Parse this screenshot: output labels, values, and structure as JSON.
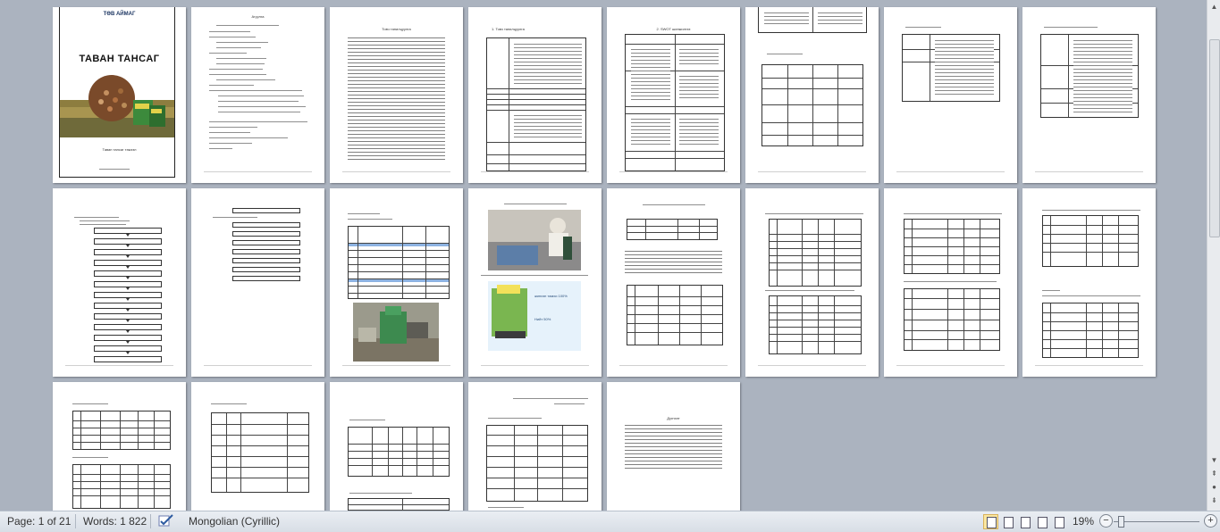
{
  "cover": {
    "header": "ТӨВ АЙМАГ",
    "title": "ТАВАН ТАНСАГ",
    "subtitle": "Таван тансаг тэжээл"
  },
  "pages": {
    "p2_heading": "Агуулга",
    "p3_heading": "Товч танилцуулга",
    "p4_heading": "1. Товч танилцуулга",
    "p5_heading": "2. SWOT шинжилгээ",
    "p15_heading": "Дүгнэлт",
    "p10_badge_line1": "жинхэн тамхи 100%",
    "p10_badge_line2": "Нийт 50%"
  },
  "scrollbar": {
    "up_icon": "arrow-up-icon",
    "down_icon": "arrow-down-icon",
    "prev_page_icon": "double-arrow-up-icon",
    "browse_icon": "circle-icon",
    "next_page_icon": "double-arrow-down-icon"
  },
  "statusbar": {
    "page_info": "Page: 1 of 21",
    "words": "Words: 1 822",
    "language": "Mongolian (Cyrillic)",
    "zoom": "19%",
    "zoom_minus": "−",
    "zoom_plus": "+",
    "zoom_level": 0.19
  },
  "colors": {
    "canvas": "#abb3bf",
    "table_header_blue": "#8db3e2",
    "badge_bg": "#e6f2fb"
  }
}
